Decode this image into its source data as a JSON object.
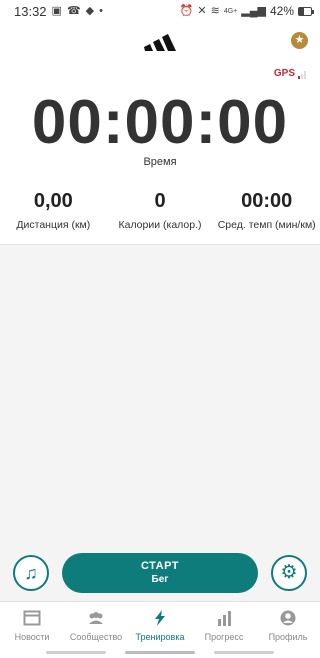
{
  "status_bar": {
    "time": "13:32",
    "battery_percent": "42%",
    "battery_level": 0.42,
    "network": "4G+",
    "left_icons": [
      "photo-icon",
      "missed-call-icon",
      "puzzle-icon",
      "dot-icon"
    ],
    "right_icons": [
      "alarm-icon",
      "mute-icon",
      "wifi-icon",
      "signal-icon",
      "battery-icon"
    ]
  },
  "header": {
    "logo": "adidas-logo",
    "star_icon": "star-icon",
    "gps_label": "GPS",
    "gps_signal_bars": 1,
    "gps_color": "#c62835"
  },
  "timer": {
    "value": "00:00:00",
    "label": "Время"
  },
  "stats": [
    {
      "value": "0,00",
      "label": "Дистанция (км)"
    },
    {
      "value": "0",
      "label": "Калории (калор.)"
    },
    {
      "value": "00:00",
      "label": "Сред. темп (мин/км)"
    }
  ],
  "actions": {
    "music_icon": "music-note-icon",
    "start_title": "СТАРТ",
    "start_subtitle": "Бег",
    "settings_icon": "gear-icon",
    "accent_color": "#0e7c7b"
  },
  "nav": {
    "items": [
      {
        "label": "Новости",
        "icon": "newsfeed-icon",
        "active": false
      },
      {
        "label": "Сообщество",
        "icon": "community-icon",
        "active": false
      },
      {
        "label": "Тренировка",
        "icon": "lightning-icon",
        "active": true
      },
      {
        "label": "Прогресс",
        "icon": "bar-chart-icon",
        "active": false
      },
      {
        "label": "Профиль",
        "icon": "profile-icon",
        "active": false
      }
    ]
  }
}
